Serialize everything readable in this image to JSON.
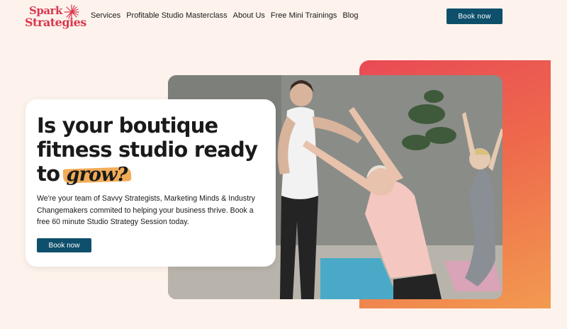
{
  "logo": {
    "line1": "Spark",
    "line2": "Strategies"
  },
  "nav": {
    "items": [
      {
        "label": "Services"
      },
      {
        "label": "Profitable Studio Masterclass"
      },
      {
        "label": "About Us"
      },
      {
        "label": "Free Mini Trainings"
      },
      {
        "label": "Blog"
      }
    ]
  },
  "header": {
    "cta_label": "Book now"
  },
  "hero": {
    "headline_line1": "Is your boutique",
    "headline_line2": "fitness studio ready",
    "headline_line3_prefix": "to ",
    "headline_highlight": "grow?",
    "body": "We're your team of Savvy Strategists, Marketing Minds & Industry Changemakers commited to helping your business thrive. Book a free 60 minute Studio Strategy Session today.",
    "cta_label": "Book now"
  },
  "colors": {
    "brand_red": "#d9374f",
    "button_teal": "#0e4f6b",
    "page_bg": "#fdf3ec",
    "gradient_start": "#e94a55",
    "gradient_end": "#f29a50",
    "highlight_orange": "#f0a346"
  },
  "icons": {
    "logo_mark": "sunburst-icon"
  }
}
